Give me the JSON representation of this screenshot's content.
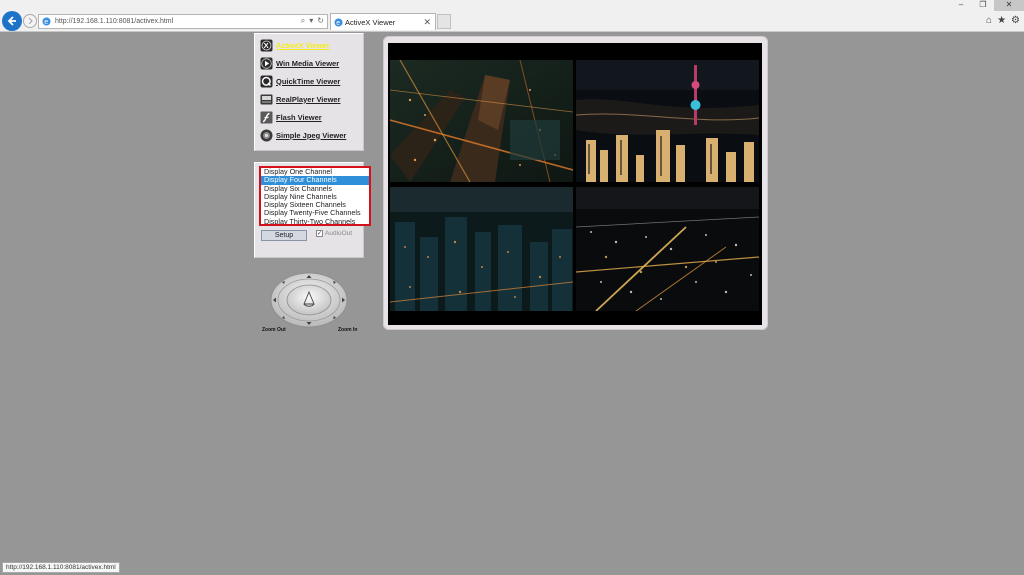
{
  "browser": {
    "address_url": "http://192.168.1.110:8081/activex.html",
    "tab_title": "ActiveX Viewer",
    "status_url": "http://192.168.1.110:8081/activex.html"
  },
  "menu": {
    "items": [
      {
        "label": "ActiveX Viewer",
        "icon": "activex-icon",
        "active": true
      },
      {
        "label": "Win Media Viewer",
        "icon": "play-icon",
        "active": false
      },
      {
        "label": "QuickTime Viewer",
        "icon": "quicktime-icon",
        "active": false
      },
      {
        "label": "RealPlayer Viewer",
        "icon": "realplayer-icon",
        "active": false
      },
      {
        "label": "Flash Viewer",
        "icon": "flash-icon",
        "active": false
      },
      {
        "label": "Simple Jpeg Viewer",
        "icon": "jpeg-icon",
        "active": false
      }
    ]
  },
  "channels": {
    "options": [
      "Display One Channel",
      "Display Four Channels",
      "Display Six Channels",
      "Display Nine Channels",
      "Display Sixteen Channels",
      "Display Twenty-Five Channels",
      "Display Thirty-Two Channels"
    ],
    "selected_index": 1,
    "setup_label": "Setup",
    "audio_label": "AudioOut",
    "audio_checked": true
  },
  "ptz": {
    "zoom_out_label": "Zoom Out",
    "zoom_in_label": "Zoom In"
  },
  "colors": {
    "accent_selected": "#2f8fd8",
    "highlight_border": "#d4101a",
    "active_link": "#f4ec1e"
  }
}
